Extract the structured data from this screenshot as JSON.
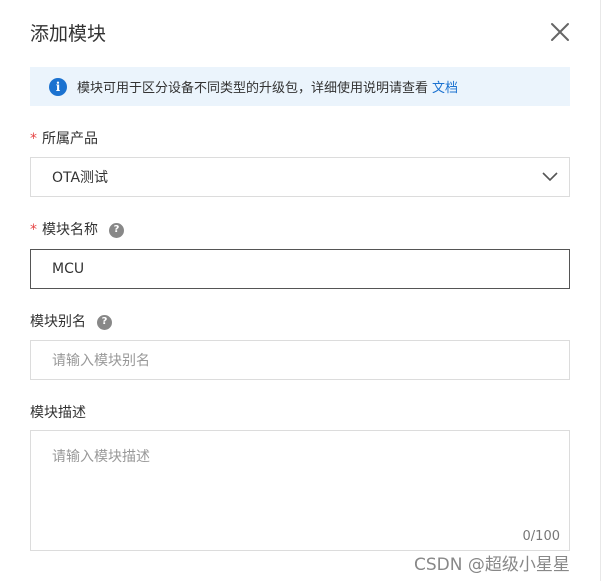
{
  "dialog": {
    "title": "添加模块",
    "close_icon": "close-icon"
  },
  "notice": {
    "icon": "info-icon",
    "text": "模块可用于区分设备不同类型的升级包，详细使用说明请查看",
    "link": "文档",
    "accent": "#1b72d0",
    "background": "#ebf4fc"
  },
  "product": {
    "required_mark": "*",
    "label": "所属产品",
    "value": "OTA测试",
    "dropdown_icon": "chevron-down-icon"
  },
  "module_name": {
    "required_mark": "*",
    "label": "模块名称",
    "help_icon": "question-icon",
    "help_glyph": "?",
    "value": "MCU"
  },
  "module_alias": {
    "label": "模块别名",
    "help_icon": "question-icon",
    "help_glyph": "?",
    "placeholder": "请输入模块别名"
  },
  "module_desc": {
    "label": "模块描述",
    "placeholder": "请输入模块描述",
    "counter": "0/100"
  },
  "watermark": "CSDN @超级小星星"
}
